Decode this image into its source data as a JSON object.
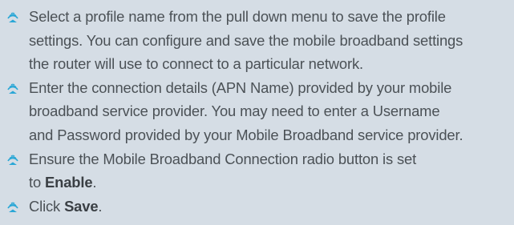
{
  "icon": {
    "name": "wifi-signal-icon",
    "color": "#2aa7d6"
  },
  "steps": [
    {
      "lines": [
        "Select a profile name from the pull down menu to save the profile",
        "settings. You can configure and save the mobile broadband settings",
        "the router will use to connect to a particular network."
      ]
    },
    {
      "lines": [
        "Enter the connection details (APN Name) provided by your mobile",
        "broadband service provider. You may need to enter a Username",
        "and Password provided by your Mobile Broadband service provider."
      ]
    },
    {
      "lines": [
        "Ensure the Mobile Broadband Connection radio button is set"
      ],
      "last_prefix": "to ",
      "last_bold": "Enable",
      "last_suffix": "."
    },
    {
      "prefix": "Click ",
      "bold": "Save",
      "suffix": "."
    }
  ]
}
